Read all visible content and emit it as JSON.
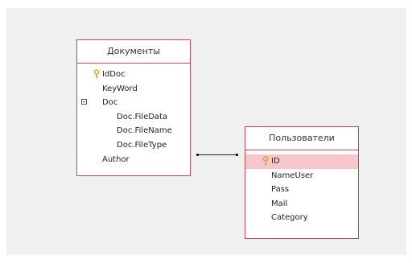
{
  "tables": [
    {
      "title": "Документы",
      "fields": [
        {
          "label": "IdDoc",
          "key": true
        },
        {
          "label": "KeyWord"
        },
        {
          "label": "Doc",
          "expandable": true
        },
        {
          "label": "Doc.FileData",
          "sub": true
        },
        {
          "label": "Doc.FileName",
          "sub": true
        },
        {
          "label": "Doc.FileType",
          "sub": true
        },
        {
          "label": "Author"
        }
      ]
    },
    {
      "title": "Пользователи",
      "fields": [
        {
          "label": "ID",
          "key": true,
          "selected": true
        },
        {
          "label": "NameUser"
        },
        {
          "label": "Pass"
        },
        {
          "label": "Mail"
        },
        {
          "label": "Category"
        }
      ]
    }
  ],
  "relationship": {
    "from": "Документы.Author",
    "to": "Пользователи.ID"
  },
  "colors": {
    "table_border": "#b94a5a",
    "selected_row": "#f6c6ca",
    "key_icon": "#d7a63a"
  },
  "icons": {
    "primary_key": "key-icon",
    "collapse": "collapse-icon"
  }
}
